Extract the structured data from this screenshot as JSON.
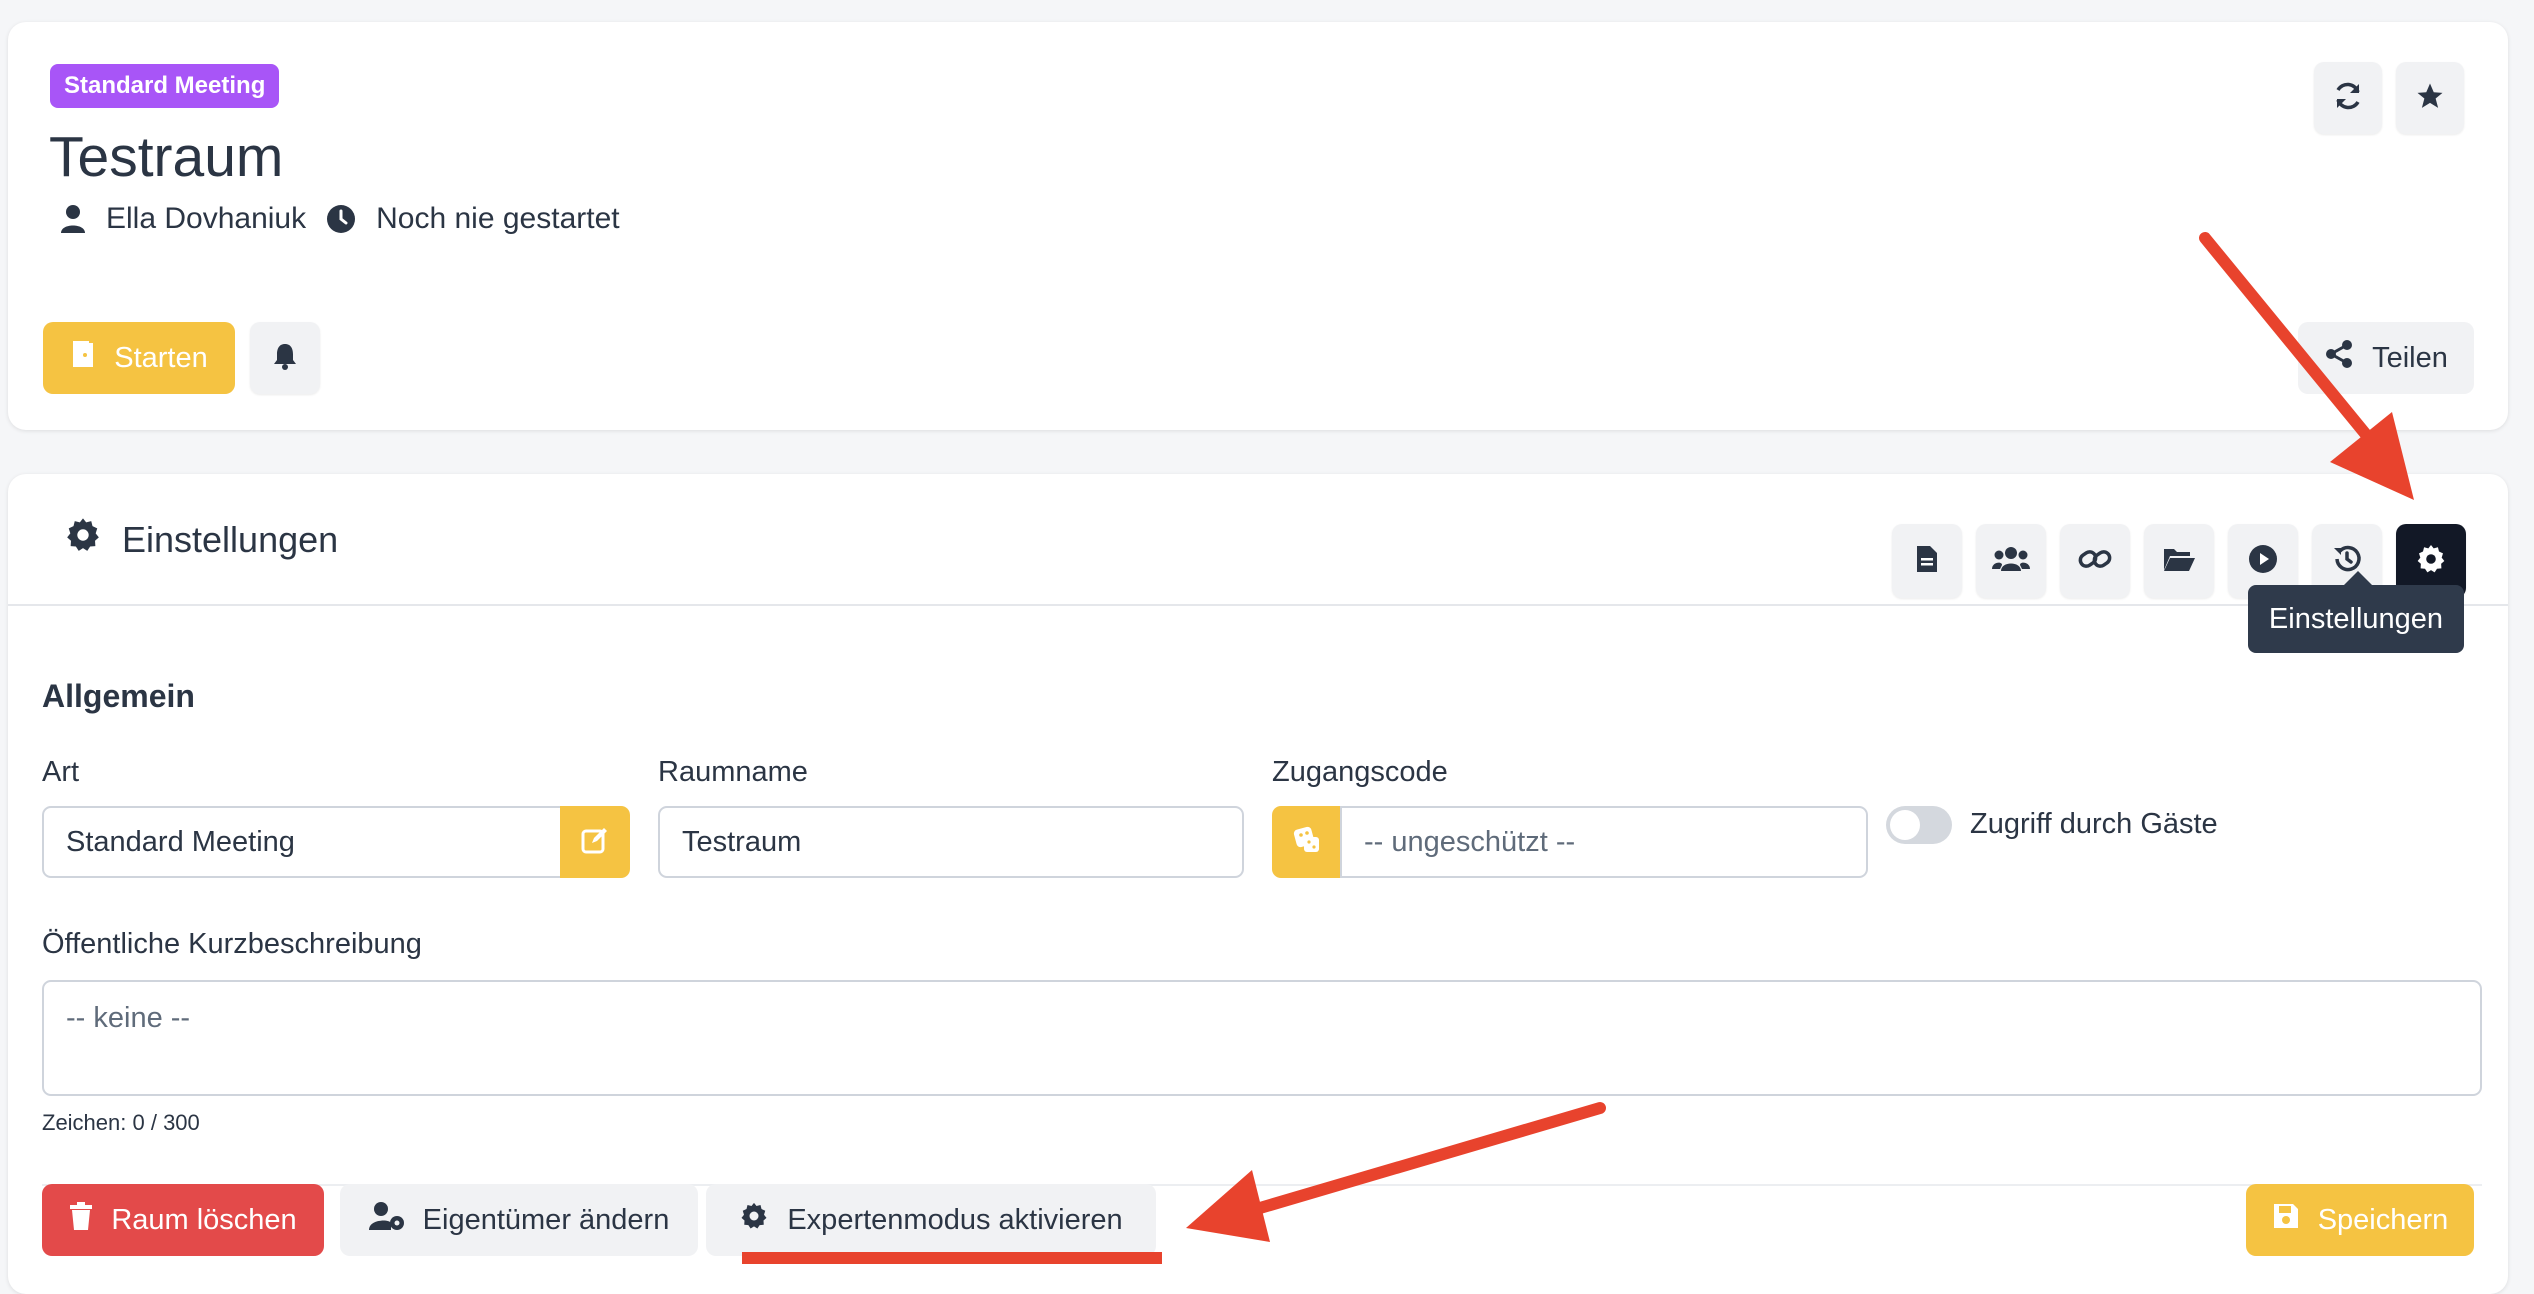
{
  "room": {
    "badge": "Standard Meeting",
    "title": "Testraum",
    "owner": "Ella Dovhaniuk",
    "status": "Noch nie gestartet"
  },
  "actions": {
    "start_label": "Starten",
    "share_label": "Teilen"
  },
  "settings": {
    "title": "Einstellungen",
    "tooltip": "Einstellungen",
    "tabs": [
      "description-icon",
      "members-icon",
      "link-icon",
      "files-icon",
      "recordings-icon",
      "history-icon",
      "settings-icon"
    ],
    "general_heading": "Allgemein",
    "art_label": "Art",
    "art_value": "Standard Meeting",
    "roomname_label": "Raumname",
    "roomname_value": "Testraum",
    "access_code_label": "Zugangscode",
    "access_code_placeholder": "-- ungeschützt --",
    "guest_access_label": "Zugriff durch Gäste",
    "description_label": "Öffentliche Kurzbeschreibung",
    "description_placeholder": "-- keine --",
    "char_counter": "Zeichen: 0 / 300",
    "delete_label": "Raum löschen",
    "change_owner_label": "Eigentümer ändern",
    "expert_mode_label": "Expertenmodus aktivieren",
    "save_label": "Speichern"
  },
  "colors": {
    "accent_yellow": "#f5c342",
    "danger_red": "#e34a4a",
    "badge_purple": "#a855f7",
    "annotation_red": "#e8432d"
  }
}
